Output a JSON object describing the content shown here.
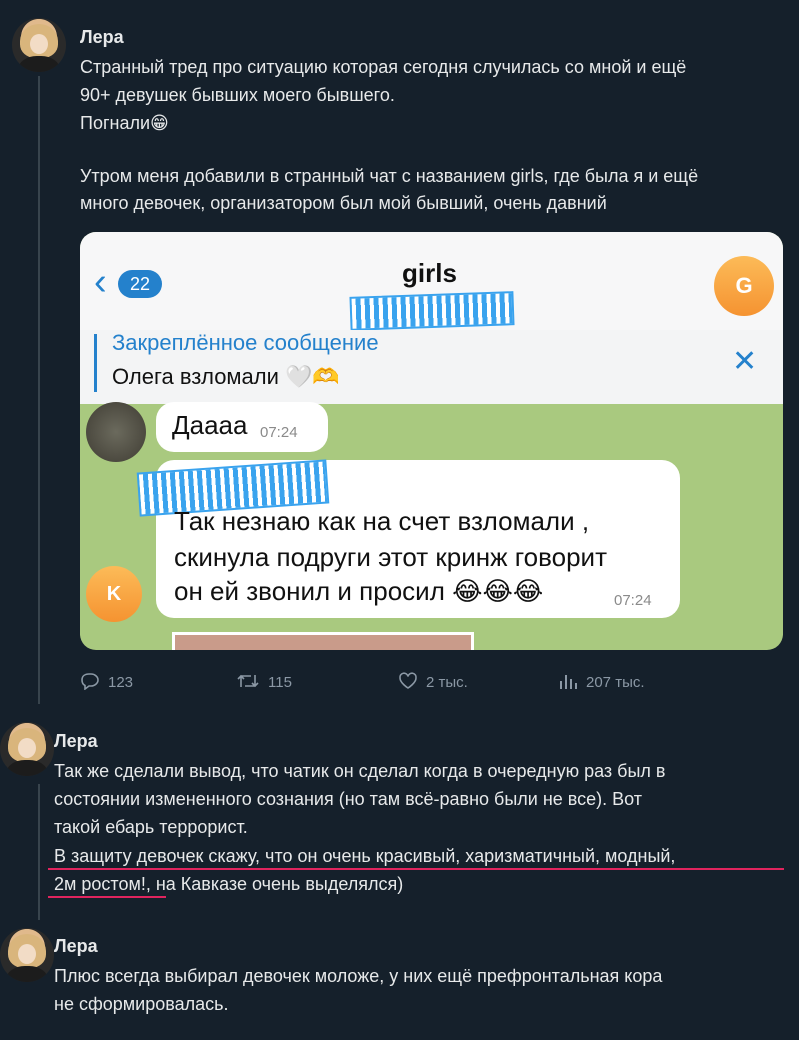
{
  "tweets": [
    {
      "author": "Лера",
      "lines": [
        "Странный тред про ситуацию которая сегодня случилась со мной и ещё",
        "90+ девушек бывших моего бывшего.",
        "Погнали😁",
        "",
        "Утром меня добавили в странный чат с названием girls, где была я и ещё",
        "много девочек, организатором был мой бывший, очень давний"
      ],
      "embed": {
        "unread_count": "22",
        "chat_title": "girls",
        "chat_avatar_letter": "G",
        "pinned_title": "Закреплённое сообщение",
        "pinned_text": "Олега взломали 🤍🫶",
        "msg1_text": "Даааа",
        "msg1_time": "07:24",
        "msg2_lines": [
          "Так незнаю как на счет взломали ,",
          "скинула подруги этот кринж говорит",
          "он ей звонил и просил 😂😂😂"
        ],
        "msg2_time": "07:24",
        "msg2_avatar_letter": "K"
      },
      "stats": {
        "replies": "123",
        "retweets": "115",
        "likes": "2 тыс.",
        "views": "207 тыс."
      }
    },
    {
      "author": "Лера",
      "lines": [
        "Так же сделали вывод, что чатик он сделал когда в очередную раз был в",
        "состоянии измененного сознания (но там всё-равно были не все). Вот",
        "такой ебарь террорист.",
        "В защиту девочек скажу, что он очень красивый, харизматичный, модный,",
        "2м ростом!, на Кавказе очень выделялся)"
      ]
    },
    {
      "author": "Лера",
      "lines": [
        "Плюс всегда выбирал девочек моложе, у них ещё префронтальная кора",
        "не сформировалась."
      ]
    }
  ],
  "colors": {
    "background": "#15202b",
    "text": "#e7e9ea",
    "muted": "#8b98a5",
    "telegram_blue": "#2481cc",
    "underline_red": "#e0245e"
  }
}
